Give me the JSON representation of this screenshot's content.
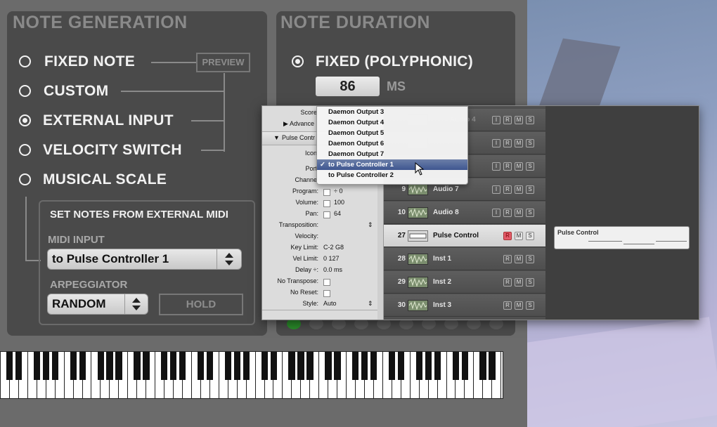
{
  "note_generation": {
    "title": "NOTE GENERATION",
    "preview_label": "PREVIEW",
    "options": [
      {
        "label": "FIXED NOTE",
        "selected": false
      },
      {
        "label": "CUSTOM",
        "selected": false
      },
      {
        "label": "EXTERNAL INPUT",
        "selected": true
      },
      {
        "label": "VELOCITY SWITCH",
        "selected": false
      },
      {
        "label": "MUSICAL SCALE",
        "selected": false
      }
    ],
    "external_midi": {
      "title": "SET NOTES FROM EXTERNAL MIDI",
      "midi_input_label": "MIDI INPUT",
      "midi_input_value": "to Pulse Controller 1",
      "arpeggiator_label": "ARPEGGIATOR",
      "arpeggiator_value": "RANDOM",
      "hold_label": "HOLD"
    }
  },
  "note_duration": {
    "title": "NOTE DURATION",
    "mode_label": "FIXED (POLYPHONIC)",
    "mode_selected": true,
    "value": "86",
    "unit": "MS"
  },
  "inspector": {
    "score_label": "Score",
    "advanced_label": "Advance",
    "section_label": "Pulse Contr",
    "icon_label": "Icon",
    "port_label": "Port",
    "channel_label": "Channe",
    "params": [
      {
        "label": "Program:",
        "value": "÷    0"
      },
      {
        "label": "Volume:",
        "value": "100"
      },
      {
        "label": "Pan:",
        "value": "64"
      },
      {
        "label": "Transposition:",
        "value": ""
      },
      {
        "label": "Velocity:",
        "value": ""
      },
      {
        "label": "Key Limit:",
        "value": "C-2  G8"
      },
      {
        "label": "Vel Limit:",
        "value": "0     127"
      },
      {
        "label": "Delay ÷:",
        "value": "0.0 ms"
      },
      {
        "label": "No Transpose:",
        "value": ""
      },
      {
        "label": "No Reset:",
        "value": ""
      },
      {
        "label": "Style:",
        "value": "Auto"
      }
    ]
  },
  "port_menu": {
    "items": [
      {
        "label": "Daemon Output 3",
        "checked": false
      },
      {
        "label": "Daemon Output 4",
        "checked": false
      },
      {
        "label": "Daemon Output 5",
        "checked": false
      },
      {
        "label": "Daemon Output 6",
        "checked": false
      },
      {
        "label": "Daemon Output 7",
        "checked": false
      },
      {
        "label": "to Pulse Controller 1",
        "checked": true
      },
      {
        "label": "to Pulse Controller 2",
        "checked": false
      }
    ],
    "check_glyph": "✓"
  },
  "tracks": [
    {
      "num": "9",
      "name": "Audio 7",
      "type": "audio",
      "buttons": [
        "I",
        "R",
        "M",
        "S"
      ]
    },
    {
      "num": "10",
      "name": "Audio 8",
      "type": "audio",
      "buttons": [
        "I",
        "R",
        "M",
        "S"
      ]
    },
    {
      "num": "27",
      "name": "Pulse Control",
      "type": "midi",
      "selected": true,
      "buttons": [
        "R",
        "M",
        "S"
      ]
    },
    {
      "num": "28",
      "name": "Inst 1",
      "type": "inst",
      "buttons": [
        "R",
        "M",
        "S"
      ]
    },
    {
      "num": "29",
      "name": "Inst 2",
      "type": "inst",
      "buttons": [
        "R",
        "M",
        "S"
      ]
    },
    {
      "num": "30",
      "name": "Inst 3",
      "type": "inst",
      "buttons": [
        "R",
        "M",
        "S"
      ]
    }
  ],
  "hidden_track_buttons": [
    "I",
    "R",
    "M",
    "S"
  ],
  "region_label": "Pulse Control",
  "colors": {
    "app_bg": "#6b6b6b",
    "panel_bg": "#4a4a4a",
    "title_gray": "#8a8a8a",
    "record_red": "#e35b6a",
    "menu_highlight": "#3e5690"
  }
}
